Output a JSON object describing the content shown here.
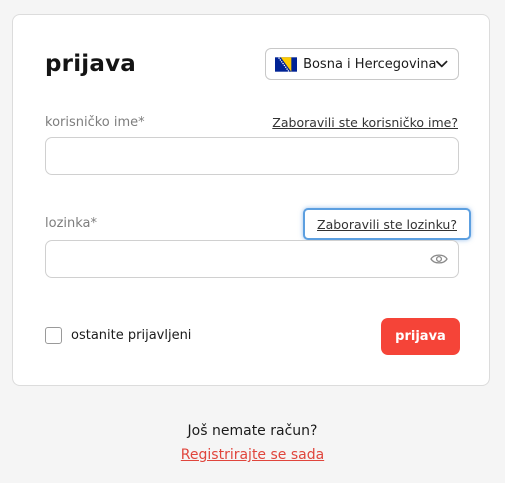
{
  "login": {
    "title": "prijava",
    "language": {
      "label": "Bosna i Hercegovina",
      "flag_icon": "bosnia-herzegovina-flag-icon",
      "chevron_icon": "chevron-down-icon"
    },
    "username": {
      "label": "korisničko ime*",
      "forgot_link": "Zaboravili ste korisničko ime?",
      "value": ""
    },
    "password": {
      "label": "lozinka*",
      "forgot_link": "Zaboravili ste lozinku?",
      "value": "",
      "reveal_icon": "eye-icon"
    },
    "remember": {
      "label": "ostanite prijavljeni",
      "checked": false
    },
    "submit_label": "prijava"
  },
  "signup": {
    "question": "Još nemate račun?",
    "link": "Registrirajte se sada"
  },
  "colors": {
    "accent": "#f54438",
    "link_red": "#e0453c",
    "focus_ring": "#5c9fe0"
  }
}
